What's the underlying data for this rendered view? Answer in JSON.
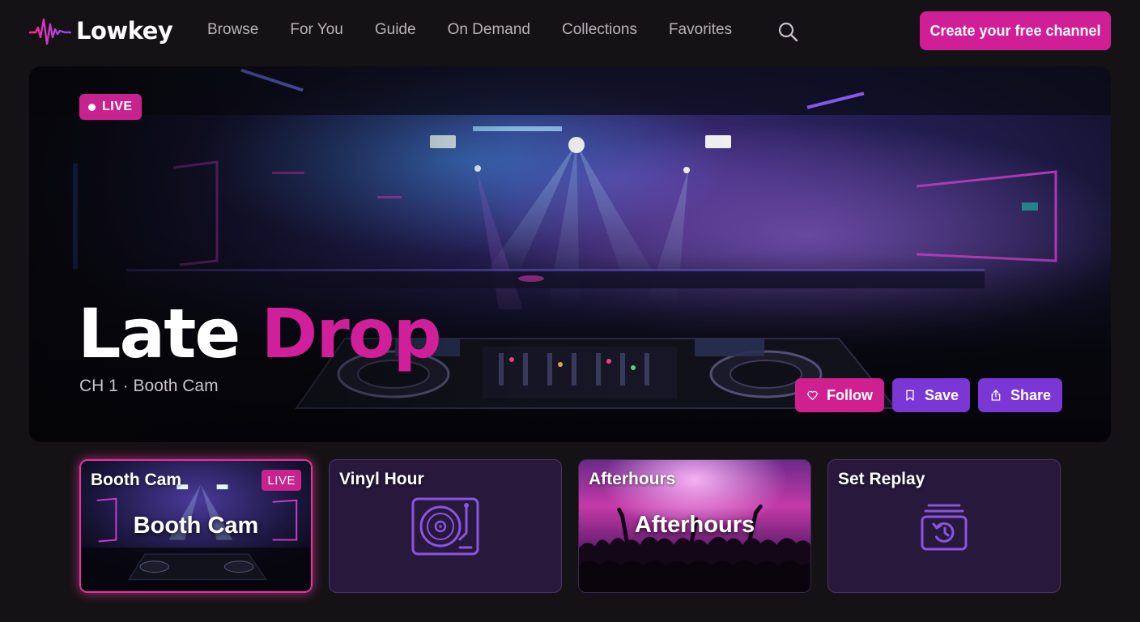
{
  "app": {
    "name": "Lowkey"
  },
  "nav": {
    "links": [
      "Browse",
      "For You",
      "Guide",
      "On Demand",
      "Collections",
      "Favorites"
    ],
    "cta_label": "Create your free channel"
  },
  "hero": {
    "live_label": "LIVE",
    "title_part1": "Late",
    "title_part2": "Drop",
    "subtitle": "CH 1 · Booth Cam",
    "actions": {
      "follow": "Follow",
      "save": "Save",
      "share": "Share"
    }
  },
  "cards": [
    {
      "title": "Booth Cam",
      "overlay": "Booth Cam",
      "badge": "LIVE",
      "active": true,
      "icon": "booth-image"
    },
    {
      "title": "Vinyl Hour",
      "overlay": "",
      "badge": "",
      "active": false,
      "icon": "turntable-icon"
    },
    {
      "title": "Afterhours",
      "overlay": "Afterhours",
      "badge": "",
      "active": false,
      "icon": "crowd-image"
    },
    {
      "title": "Set Replay",
      "overlay": "",
      "badge": "",
      "active": false,
      "icon": "replay-history-icon"
    }
  ],
  "colors": {
    "accent_pink": "#d01e96",
    "accent_purple": "#7a37d6",
    "card_bg": "#28183c",
    "background": "#141214"
  }
}
